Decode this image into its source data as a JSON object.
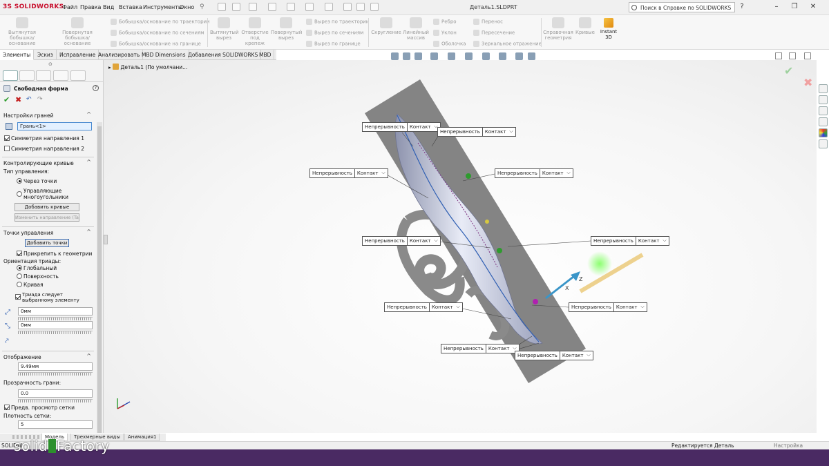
{
  "titlebar": {
    "brand": "SOLIDWORKS",
    "menu": [
      "Файл",
      "Правка",
      "Вид",
      "Вставка",
      "Инструменты",
      "Окно"
    ],
    "document_title": "Деталь1.SLDPRT",
    "help_placeholder": "Поиск в Справке по SOLIDWORKS"
  },
  "ribbon": {
    "extruded_boss": "Вытянутая бобышка/основание",
    "revolved_boss": "Повернутая бобышка/основание",
    "swept_boss": "Бобышка/основание по траектории",
    "lofted_boss": "Бобышка/основание по сечениям",
    "boundary_boss": "Бобышка/основание на границе",
    "extruded_cut": "Вытянутый вырез",
    "hole_wizard": "Отверстие под крепеж",
    "revolved_cut": "Повернутый вырез",
    "swept_cut": "Вырез по траектории",
    "lofted_cut": "Вырез по сечениям",
    "boundary_cut": "Вырез по границе",
    "fillet": "Скругление",
    "linear_pattern": "Линейный массив",
    "rib": "Ребро",
    "draft": "Уклон",
    "shell": "Оболочка",
    "wrap": "Перенос",
    "intersect": "Пересечение",
    "mirror": "Зеркальное отражение",
    "ref_geometry": "Справочная геометрия",
    "curves": "Кривые",
    "instant3d": "Instant 3D"
  },
  "tabs": [
    "Элементы",
    "Эскиз",
    "Исправление",
    "Анализировать",
    "MBD Dimensions",
    "Добавления SOLIDWORKS",
    "MBD"
  ],
  "tree": {
    "root": "Деталь1  (По умолчани..."
  },
  "pm": {
    "title": "Свободная форма",
    "faces_section": "Настройки граней",
    "face_value": "Грань<1>",
    "sym1": "Симметрия направления 1",
    "sym2": "Симметрия направления 2",
    "curves_section": "Контролирующие кривые",
    "control_type": "Тип управления:",
    "through_points": "Через точки",
    "control_polygons": "Управляющие многоугольники",
    "add_curves": "Добавить кривые",
    "flip_direction": "Изменить направление (Tab)",
    "points_section": "Точки управления",
    "add_points": "Добавить точки",
    "snap_geometry": "Прикрепить к геометрии",
    "triad_orientation": "Ориентация триады:",
    "global": "Глобальный",
    "surface": "Поверхность",
    "curve": "Кривая",
    "triad_follow": "Триада следует выбранному элементу",
    "val1": "0мм",
    "val2": "0мм",
    "display_section": "Отображение",
    "display_val": "9.49мм",
    "transparency_label": "Прозрачность грани:",
    "transparency_val": "0.0",
    "mesh_preview": "Предв. просмотр сетки",
    "mesh_density_label": "Плотность сетки:",
    "mesh_density_val": "5"
  },
  "callouts": [
    {
      "left": "Непрерывность",
      "right": "Контакт"
    },
    {
      "left": "Непрерывность",
      "right": "Контакт"
    },
    {
      "left": "Непрерывность",
      "right": "Контакт"
    },
    {
      "left": "Непрерывность",
      "right": "Контакт"
    },
    {
      "left": "Непрерывность",
      "right": "Контакт"
    },
    {
      "left": "Непрерывность",
      "right": "Контакт"
    },
    {
      "left": "Непрерывность",
      "right": "Контакт"
    },
    {
      "left": "Непрерывность",
      "right": "Контакт"
    },
    {
      "left": "Непрерывность",
      "right": "Контакт"
    },
    {
      "left": "Непрерывность",
      "right": "Контакт"
    }
  ],
  "bottom_tabs": [
    "Модель",
    "Трехмерные виды",
    "Анимация1"
  ],
  "status": {
    "left": "SOLIDW",
    "editing": "Редактируется Деталь",
    "custom": "Настройка"
  },
  "brand_overlay": {
    "part1": "solid",
    "part2": "Factory"
  },
  "colors": {
    "accent": "#c8102e",
    "brand_bg": "#4a2a63",
    "plane": "#7d7d7d",
    "body": "#c7cbe0"
  }
}
